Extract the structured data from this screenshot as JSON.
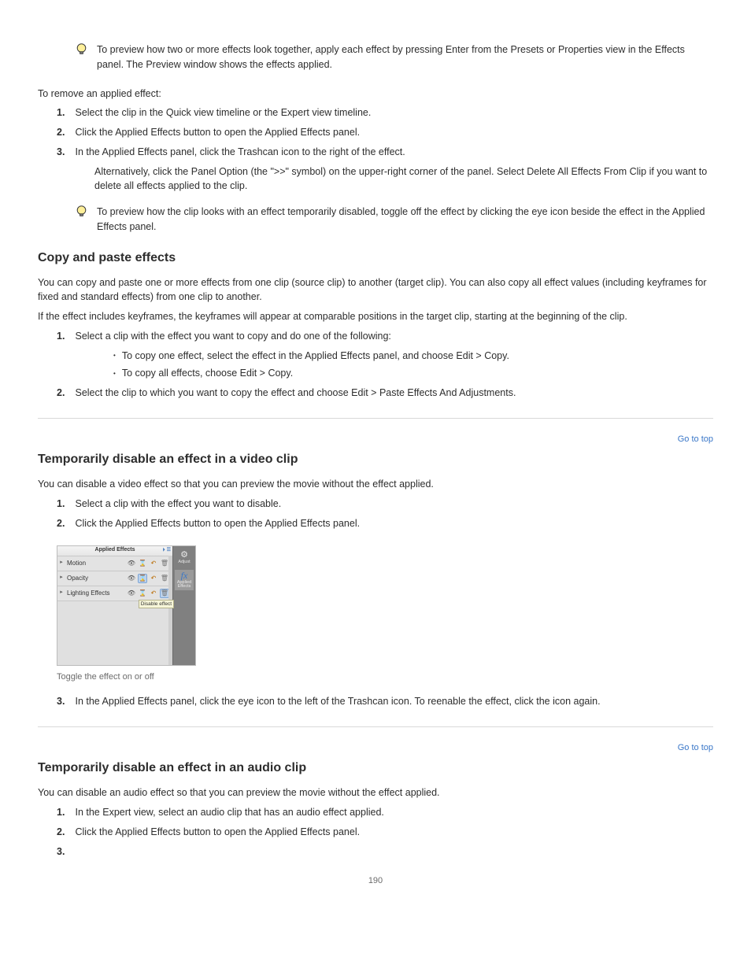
{
  "tip1": "To preview how two or more effects look together, apply each effect by pressing Enter from the Presets or Properties view in the Effects panel. The Preview window shows the effects applied.",
  "p_removeIntro": "To remove an applied effect:",
  "step1_num": "1.",
  "step1_text": "Select the clip in the Quick view timeline or the Expert view timeline.",
  "step2_num": "2.",
  "step2_text": "Click the Applied Effects button to open the Applied Effects panel.",
  "step3_num": "3.",
  "step3_text": "In the Applied Effects panel, click the Trashcan icon to the right of the effect.",
  "p_alt": "Alternatively, click the Panel Option (the \">>\" symbol) on the upper-right corner of the panel. Select Delete All Effects From Clip if you want to delete all effects applied to the clip.",
  "tip2": "To preview how the clip looks with an effect temporarily disabled, toggle off the effect by clicking the eye icon beside the effect in the Applied Effects panel.",
  "h_copy": "Copy and paste effects",
  "p_copy1": "You can copy and paste one or more effects from one clip (source clip) to another (target clip). You can also copy all effect values (including keyframes for fixed and standard effects) from one clip to another.",
  "p_copy2": "If the effect includes keyframes, the keyframes will appear at comparable positions in the target clip, starting at the beginning of the clip.",
  "scp_num": "1.",
  "scp_bullet": "Select a clip with the effect you want to copy and do one of the following:",
  "scp_b1": "To copy one effect, select the effect in the Applied Effects panel, and choose Edit > Copy.",
  "scp_b2": "To copy all effects, choose Edit > Copy.",
  "scp_num2": "2.",
  "scp_step2": "Select the clip to which you want to copy the effect and choose Edit > Paste Effects And Adjustments.",
  "h_disable": "Temporarily disable an effect in a video clip",
  "p_disable": "You can disable a video effect so that you can preview the movie without the effect applied.",
  "d_num1": "1.",
  "d_step1": "Select a clip with the effect you want to disable.",
  "d_num2": "2.",
  "d_step2": "Click the Applied Effects button to open the Applied Effects panel.",
  "d_num3": "3.",
  "d_step3": "In the Applied Effects panel, click the eye icon to the left of the Trashcan icon. To reenable the effect, click the icon again.",
  "panel": {
    "title": "Applied Effects",
    "rows": [
      {
        "name": "Motion"
      },
      {
        "name": "Opacity"
      },
      {
        "name": "Lighting Effects"
      }
    ],
    "tooltip": "Disable effect",
    "side": [
      {
        "label": "Adjust"
      },
      {
        "label": "Applied Effects"
      }
    ]
  },
  "caption_panel": "Toggle the effect on or off",
  "goto_top": "Go to top",
  "h_audio": "Temporarily disable an effect in an audio clip",
  "p_audio": "You can disable an audio effect so that you can preview the movie without the effect applied.",
  "a_num1": "1.",
  "a_step1": "In the Expert view, select an audio clip that has an audio effect applied.",
  "a_num2": "2.",
  "a_step2": "Click the Applied Effects button to open the Applied Effects panel.",
  "a_num3": "3.",
  "page_number": "190"
}
